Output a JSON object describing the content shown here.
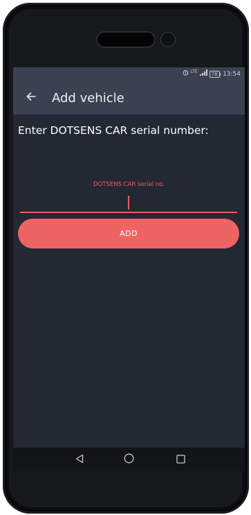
{
  "status_bar": {
    "alarm_icon": "alarm-clock-icon",
    "network_label": "LTE",
    "signal_icon": "signal-bars-icon",
    "battery_level": "78",
    "time": "13:54"
  },
  "app_bar": {
    "back_icon": "arrow-left-icon",
    "title": "Add vehicle"
  },
  "form": {
    "prompt": "Enter DOTSENS CAR serial number:",
    "field_label": "DOTSENS CAR serial no.",
    "field_value": "",
    "add_label": "ADD"
  },
  "nav_bar": {
    "back_icon": "triangle-back-icon",
    "home_icon": "circle-home-icon",
    "recents_icon": "square-recents-icon"
  },
  "colors": {
    "accent": "#ee6363",
    "screen_bg": "#232833",
    "app_bar_bg": "#3b4150",
    "nav_bar_bg": "#121418"
  }
}
